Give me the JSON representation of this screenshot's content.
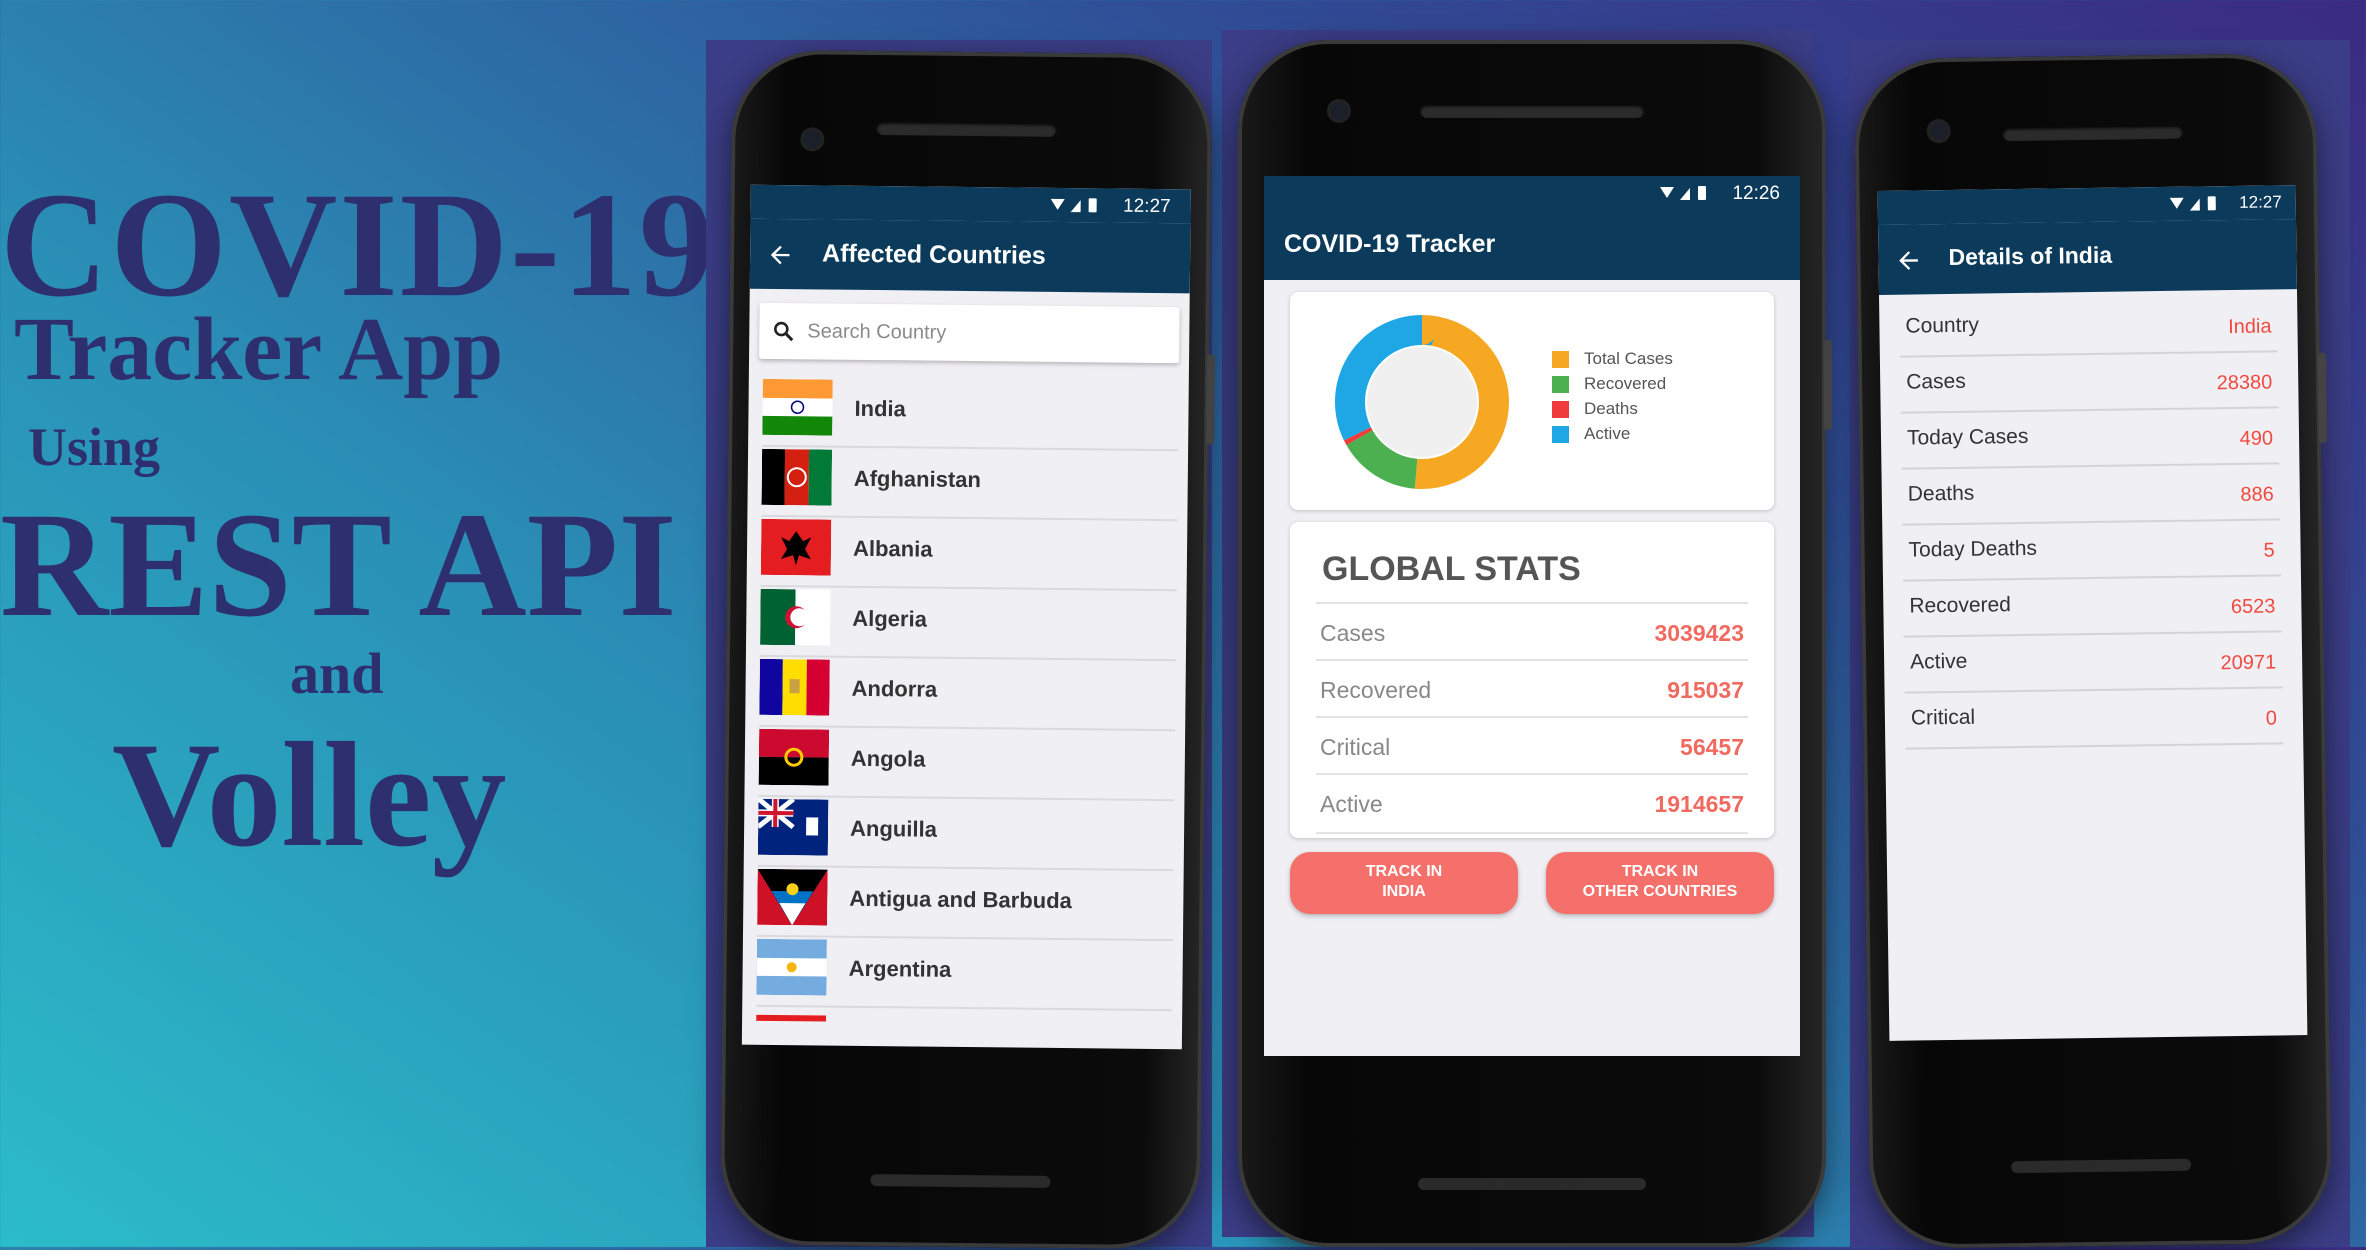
{
  "banner": {
    "line1": "COVID-19",
    "line2": "Tracker App",
    "line3": "Using",
    "line4": "REST API",
    "line5": "and",
    "line6": "Volley"
  },
  "colors": {
    "appbar": "#0b3a5b",
    "accent": "#f5706a",
    "value_red": "#f04a40",
    "banner_text": "#2e2f6e"
  },
  "phone_list": {
    "status_time": "12:27",
    "title": "Affected Countries",
    "search_placeholder": "Search Country",
    "countries": [
      {
        "name": "India",
        "flag": "india-flag"
      },
      {
        "name": "Afghanistan",
        "flag": "afghanistan-flag"
      },
      {
        "name": "Albania",
        "flag": "albania-flag"
      },
      {
        "name": "Algeria",
        "flag": "algeria-flag"
      },
      {
        "name": "Andorra",
        "flag": "andorra-flag"
      },
      {
        "name": "Angola",
        "flag": "angola-flag"
      },
      {
        "name": "Anguilla",
        "flag": "anguilla-flag"
      },
      {
        "name": "Antigua and Barbuda",
        "flag": "antigua-flag"
      },
      {
        "name": "Argentina",
        "flag": "argentina-flag"
      }
    ]
  },
  "phone_main": {
    "status_time": "12:26",
    "title": "COVID-19 Tracker",
    "legend": [
      {
        "label": "Total Cases",
        "color": "#f7a823"
      },
      {
        "label": "Recovered",
        "color": "#4caf50"
      },
      {
        "label": "Deaths",
        "color": "#ef3b3b"
      },
      {
        "label": "Active",
        "color": "#1ea6e5"
      }
    ],
    "global_title": "GLOBAL STATS",
    "stats": [
      {
        "label": "Cases",
        "value": "3039423"
      },
      {
        "label": "Recovered",
        "value": "915037"
      },
      {
        "label": "Critical",
        "value": "56457"
      },
      {
        "label": "Active",
        "value": "1914657"
      }
    ],
    "btn_india": "TRACK IN\nINDIA",
    "btn_other": "TRACK IN\nOTHER COUNTRIES"
  },
  "chart_data": {
    "type": "pie",
    "categories": [
      "Total Cases",
      "Recovered",
      "Deaths",
      "Active"
    ],
    "values": [
      3039423,
      915037,
      56457,
      1914657
    ],
    "title": ""
  },
  "phone_details": {
    "status_time": "12:27",
    "title": "Details of India",
    "rows": [
      {
        "label": "Country",
        "value": "India"
      },
      {
        "label": "Cases",
        "value": "28380"
      },
      {
        "label": "Today Cases",
        "value": "490"
      },
      {
        "label": "Deaths",
        "value": "886"
      },
      {
        "label": "Today Deaths",
        "value": "5"
      },
      {
        "label": "Recovered",
        "value": "6523"
      },
      {
        "label": "Active",
        "value": "20971"
      },
      {
        "label": "Critical",
        "value": "0"
      }
    ]
  }
}
